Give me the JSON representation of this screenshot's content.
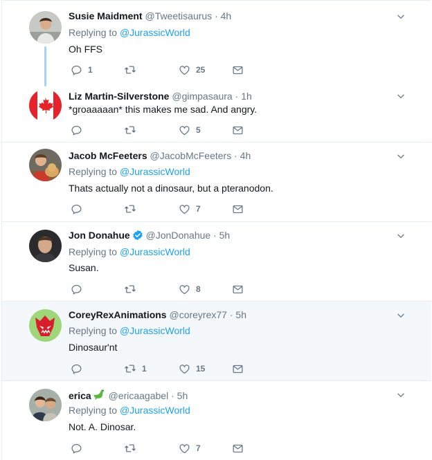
{
  "colors": {
    "link": "#1da1f2",
    "muted": "#657786",
    "highlight_bg": "#f5f8fa",
    "thread_line": "#a6d3f2"
  },
  "reply_prefix": "Replying to",
  "tweets": [
    {
      "name": "Susie Maidment",
      "handle": "@Tweetisaurus",
      "time": "4h",
      "replying_to": "@JurassicWorld",
      "text": "Oh FFS",
      "replies": "1",
      "retweets": "",
      "likes": "25",
      "avatar_icon": "person-photo"
    },
    {
      "name": "Liz Martin-Silverstone",
      "handle": "@gimpasaura",
      "time": "1h",
      "text": "*groaaaaan* this makes me sad. And angry.",
      "replies": "",
      "retweets": "",
      "likes": "5",
      "avatar_icon": "canada-flag"
    },
    {
      "name": "Jacob McFeeters",
      "handle": "@JacobMcFeeters",
      "time": "4h",
      "replying_to": "@JurassicWorld",
      "text": "Thats actually not a dinosaur, but a pteranodon.",
      "replies": "",
      "retweets": "",
      "likes": "7",
      "avatar_icon": "person-with-dog-photo"
    },
    {
      "name": "Jon Donahue",
      "handle": "@JonDonahue",
      "time": "5h",
      "replying_to": "@JurassicWorld",
      "text": "Susan.",
      "replies": "",
      "retweets": "",
      "likes": "8",
      "verified": true,
      "avatar_icon": "person-photo"
    },
    {
      "name": "CoreyRexAnimations",
      "handle": "@coreyrex77",
      "time": "5h",
      "replying_to": "@JurassicWorld",
      "text": "Dinosaur'nt",
      "replies": "",
      "retweets": "1",
      "likes": "15",
      "avatar_icon": "cartoon-dinosaur"
    },
    {
      "name": "erica",
      "handle": "@ericaagabel",
      "time": "5h",
      "replying_to": "@JurassicWorld",
      "text": "Not. A. Dinosar.",
      "replies": "",
      "retweets": "",
      "likes": "7",
      "name_emoji": "sauropod-emoji",
      "avatar_icon": "two-people-photo"
    }
  ]
}
